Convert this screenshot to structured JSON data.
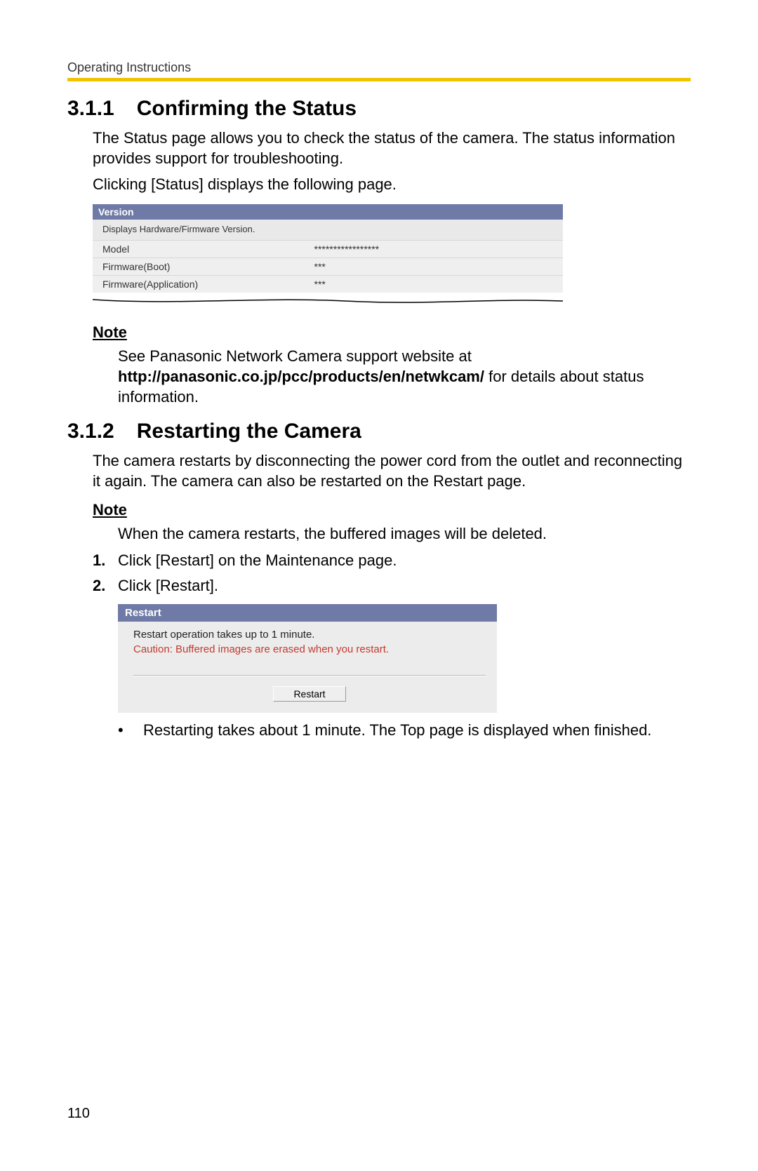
{
  "header": {
    "running_head": "Operating Instructions"
  },
  "sec311": {
    "number": "3.1.1",
    "title": "Confirming the Status",
    "para1": "The Status page allows you to check the status of the camera. The status information provides support for troubleshooting.",
    "para2": "Clicking [Status] displays the following page."
  },
  "status_shot": {
    "title": "Version",
    "desc": "Displays Hardware/Firmware Version.",
    "rows": [
      {
        "label": "Model",
        "value": "*****************"
      },
      {
        "label": "Firmware(Boot)",
        "value": "***"
      },
      {
        "label": "Firmware(Application)",
        "value": "***"
      }
    ]
  },
  "note1": {
    "heading": "Note",
    "text_pre": "See Panasonic Network Camera support website at ",
    "url": "http://panasonic.co.jp/pcc/products/en/netwkcam/",
    "text_post": " for details about status information."
  },
  "sec312": {
    "number": "3.1.2",
    "title": "Restarting the Camera",
    "para1": "The camera restarts by disconnecting the power cord from the outlet and reconnecting it again. The camera can also be restarted on the Restart page."
  },
  "note2": {
    "heading": "Note",
    "text": "When the camera restarts, the buffered images will be deleted."
  },
  "steps": {
    "items": [
      {
        "n": "1.",
        "text": "Click [Restart] on the Maintenance page."
      },
      {
        "n": "2.",
        "text": "Click [Restart]."
      }
    ]
  },
  "restart_shot": {
    "title": "Restart",
    "line1": "Restart operation takes up to 1 minute.",
    "caution": "Caution: Buffered images are erased when you restart.",
    "button": "Restart"
  },
  "bullet": {
    "text": "Restarting takes about 1 minute. The Top page is displayed when finished."
  },
  "page_number": "110"
}
